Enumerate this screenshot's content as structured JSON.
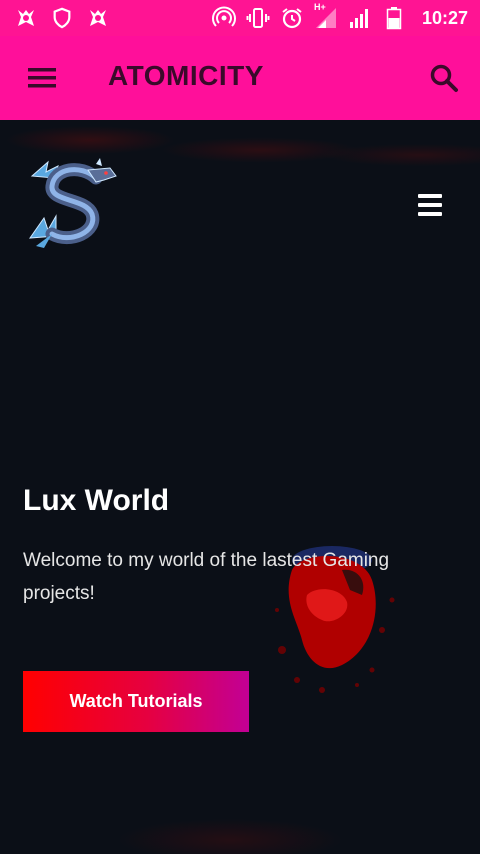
{
  "status_bar": {
    "time": "10:27",
    "network": "H+",
    "left_icons": [
      "vpn-app-icon",
      "shield-icon",
      "vpn-app-icon"
    ],
    "right_icons": [
      "hotspot-icon",
      "vibrate-icon",
      "alarm-icon",
      "signal-icon",
      "signal-icon",
      "battery-icon"
    ]
  },
  "app_bar": {
    "title": "ATOMICITY",
    "menu_icon": "hamburger-icon",
    "search_icon": "search-icon",
    "color": "#ff0f9a"
  },
  "hero": {
    "menu_icon": "bars-icon",
    "logo": "dragon-logo",
    "title": "Lux World",
    "text": "Welcome to my world of the lastest Gaming projects!",
    "cta_label": "Watch Tutorials",
    "background": "#0b0f17",
    "cta_gradient": [
      "#ff0000",
      "#c20095"
    ]
  }
}
